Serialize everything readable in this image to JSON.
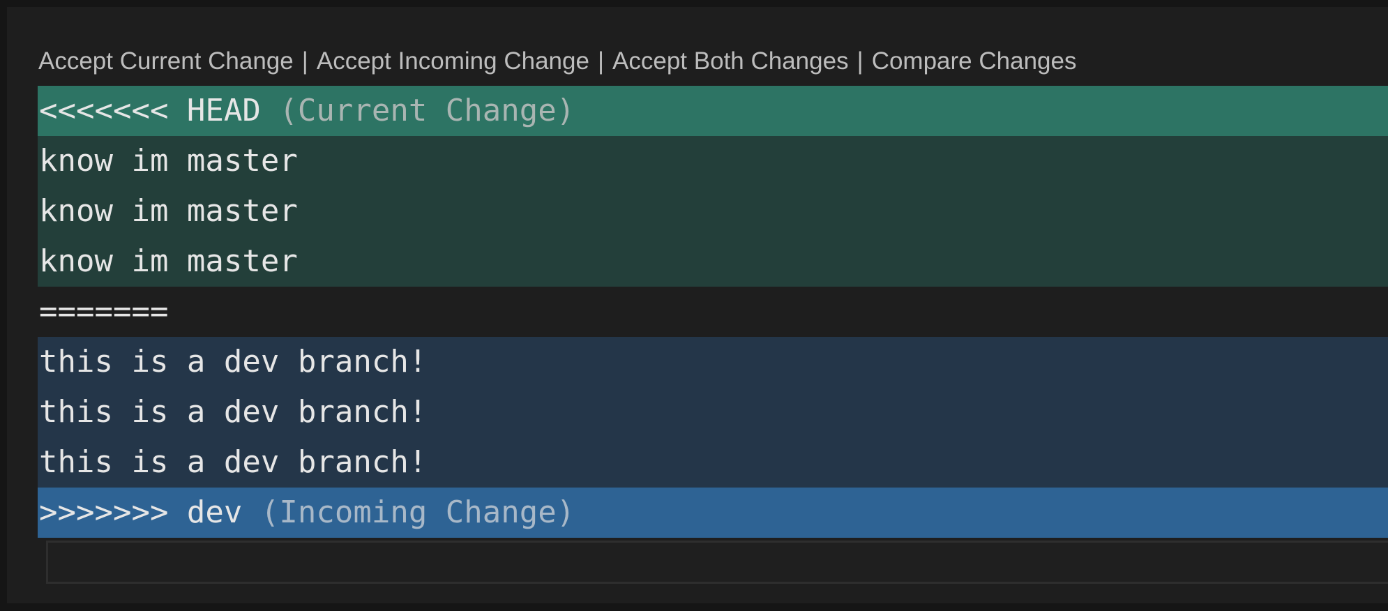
{
  "codelens": {
    "actions": [
      "Accept Current Change",
      "Accept Incoming Change",
      "Accept Both Changes",
      "Compare Changes"
    ],
    "separator": "|"
  },
  "conflict": {
    "head_marker": "<<<<<<< HEAD",
    "head_hint": "(Current Change)",
    "current_lines": [
      "know im master",
      "know im master",
      "know im master"
    ],
    "separator_marker": "=======",
    "incoming_lines": [
      "this is a dev branch!",
      "this is a dev branch!",
      "this is a dev branch!"
    ],
    "tail_marker": ">>>>>>> dev",
    "tail_hint": "(Incoming Change)"
  },
  "colors": {
    "head_marker_bg": "#2d7464",
    "current_bg": "#233f3a",
    "incoming_bg": "#243649",
    "tail_marker_bg": "#2e6394",
    "editor_bg": "#1e1e1e"
  }
}
